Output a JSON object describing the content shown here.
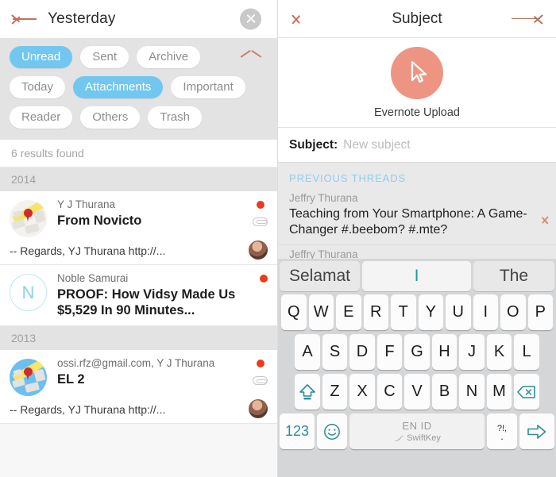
{
  "left": {
    "header": {
      "back_icon": "left-arrow-icon",
      "title": "Yesterday",
      "close_icon": "close-circle-icon"
    },
    "filters": {
      "collapse_icon": "chevron-up-icon",
      "rows": [
        [
          {
            "label": "Unread",
            "active": true
          },
          {
            "label": "Sent",
            "active": false
          },
          {
            "label": "Archive",
            "active": false
          }
        ],
        [
          {
            "label": "Today",
            "active": false
          },
          {
            "label": "Attachments",
            "active": true
          },
          {
            "label": "Important",
            "active": false
          }
        ],
        [
          {
            "label": "Reader",
            "active": false
          },
          {
            "label": "Others",
            "active": false
          },
          {
            "label": "Trash",
            "active": false
          }
        ]
      ]
    },
    "results_text": "6 results found",
    "sections": [
      {
        "year": "2014",
        "items": [
          {
            "avatar": "map-thumbnail",
            "sender": "Y J Thurana",
            "subject": "From Novicto",
            "snippet": "-- Regards, YJ Thurana http://...",
            "unread": true,
            "has_attachment": true,
            "has_mini_avatar": true
          },
          {
            "avatar": "letter-N",
            "avatar_letter": "N",
            "sender": "Noble Samurai",
            "subject": "PROOF: How Vidsy Made Us $5,529 In 90 Minutes...",
            "snippet": "",
            "unread": true,
            "has_attachment": false,
            "has_mini_avatar": false
          }
        ]
      },
      {
        "year": "2013",
        "items": [
          {
            "avatar": "map-thumbnail-blue",
            "sender": "ossi.rfz@gmail.com, Y J Thurana",
            "subject": "EL 2",
            "snippet": "-- Regards, YJ Thurana http://...",
            "unread": true,
            "has_attachment": true,
            "has_mini_avatar": true
          }
        ]
      }
    ]
  },
  "right": {
    "header": {
      "back_icon": "chevron-left-icon",
      "title": "Subject",
      "send_icon": "right-arrow-icon"
    },
    "recipient": {
      "avatar_icon": "cursor-pointer-icon",
      "name": "Evernote Upload",
      "avatar_color": "#ed9582"
    },
    "subject_field": {
      "label": "Subject:",
      "value": "",
      "placeholder": "New subject"
    },
    "previous_threads": {
      "heading": "PREVIOUS THREADS",
      "items": [
        {
          "sender": "Jeffry Thurana",
          "subject": "Teaching from Your Smartphone: A Game-Changer #.beebom? #.mte?",
          "chevron_icon": "chevron-right-icon"
        },
        {
          "sender": "Jeffry Thurana",
          "subject": "",
          "chevron_icon": "chevron-right-icon"
        }
      ]
    }
  },
  "keyboard": {
    "suggestions": [
      "Selamat",
      "I",
      "The"
    ],
    "rows": [
      [
        "Q",
        "W",
        "E",
        "R",
        "T",
        "Y",
        "U",
        "I",
        "O",
        "P"
      ],
      [
        "A",
        "S",
        "D",
        "F",
        "G",
        "H",
        "J",
        "K",
        "L"
      ],
      [
        "Z",
        "X",
        "C",
        "V",
        "B",
        "N",
        "M"
      ]
    ],
    "shift_icon": "shift-up-icon",
    "backspace_icon": "backspace-icon",
    "numeric_label": "123",
    "emoji_icon": "smiley-icon",
    "space": {
      "language": "EN ID",
      "brand": "SwiftKey",
      "brand_icon": "swiftkey-logo-icon"
    },
    "punct": {
      "top": "?!,",
      "bottom": "."
    },
    "enter_icon": "enter-arrow-icon"
  },
  "colors": {
    "accent_blue": "#71c7ef",
    "accent_salmon": "#ed9582",
    "unread_red": "#ec3a20",
    "keyboard_teal": "#2d8b96"
  }
}
